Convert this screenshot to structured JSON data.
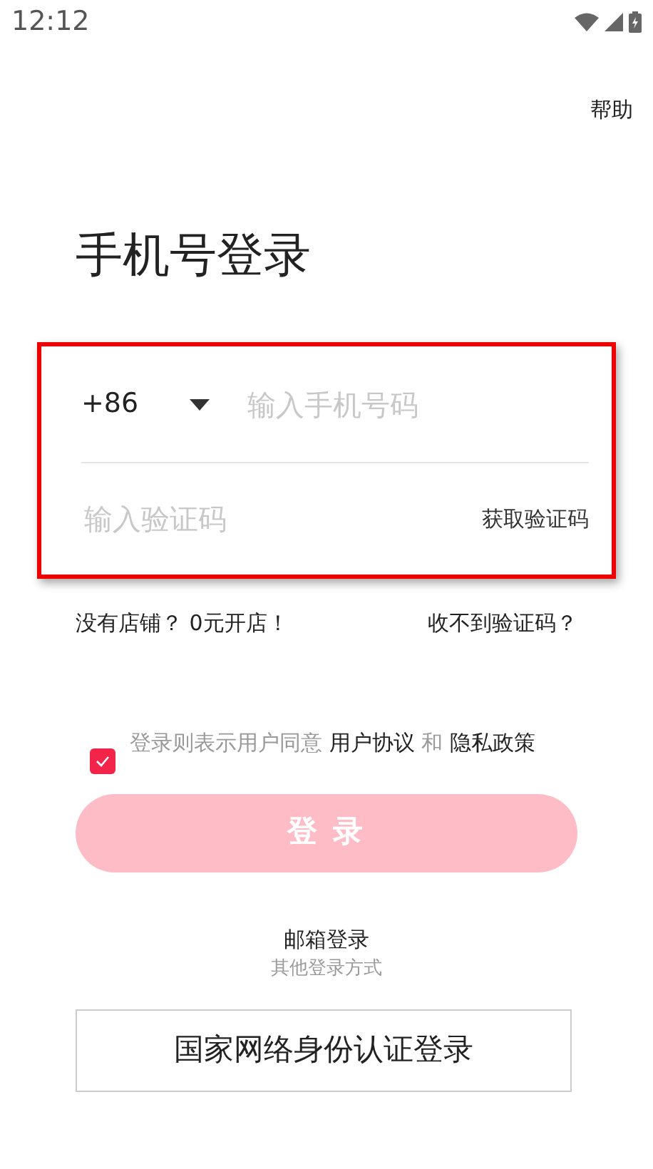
{
  "status_bar": {
    "time": "12:12"
  },
  "help": "帮助",
  "title": "手机号登录",
  "phone": {
    "country_code": "+86",
    "placeholder": "输入手机号码"
  },
  "code": {
    "placeholder": "输入验证码",
    "get_code": "获取验证码"
  },
  "highlighted": true,
  "links": {
    "open_shop": "没有店铺？ 0元开店！",
    "no_code": "收不到验证码？"
  },
  "agreement": {
    "checked": true,
    "text": "登录则表示用户同意",
    "user_agreement": "用户协议",
    "and": "和",
    "privacy": "隐私政策"
  },
  "login_button": {
    "label": "登 录",
    "disabled": true
  },
  "email_login": "邮箱登录",
  "other_methods": "其他登录方式",
  "national_id_login": "国家网络身份认证登录"
}
